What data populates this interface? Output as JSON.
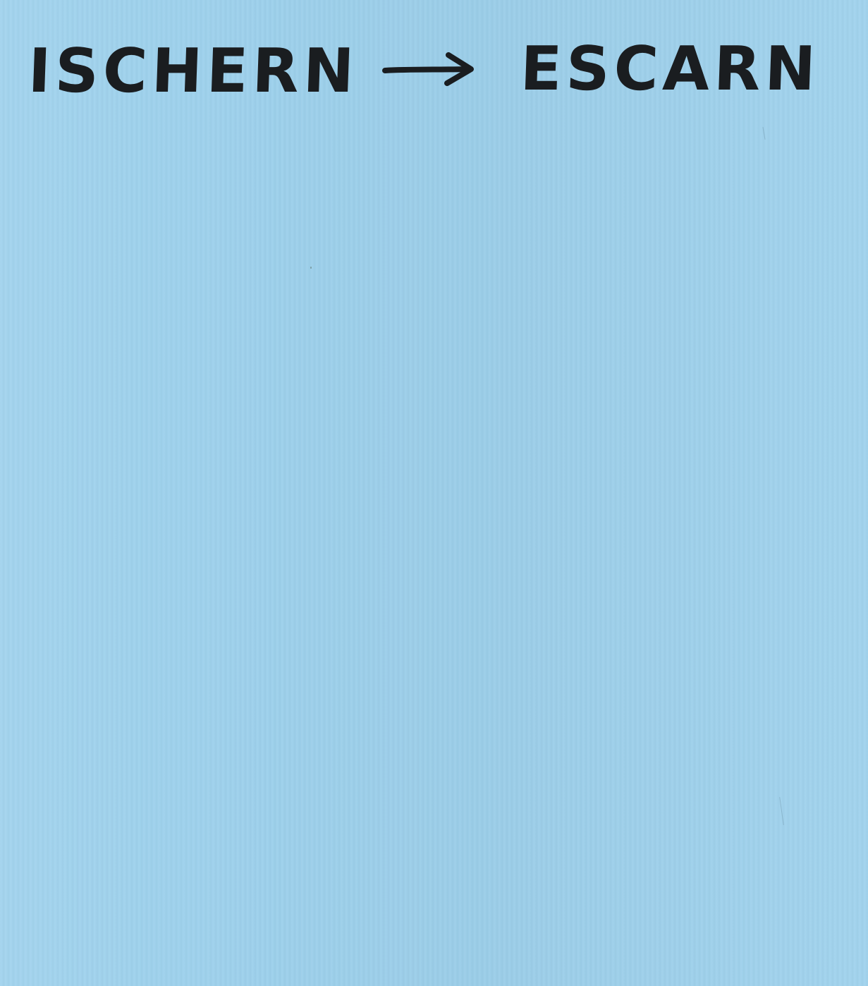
{
  "note": {
    "from_word": "ISCHERN",
    "to_word": "ESCARN",
    "arrow_icon": "right-arrow-icon",
    "paper_color": "#9ed1ec",
    "ink_color": "#1a1d20"
  }
}
